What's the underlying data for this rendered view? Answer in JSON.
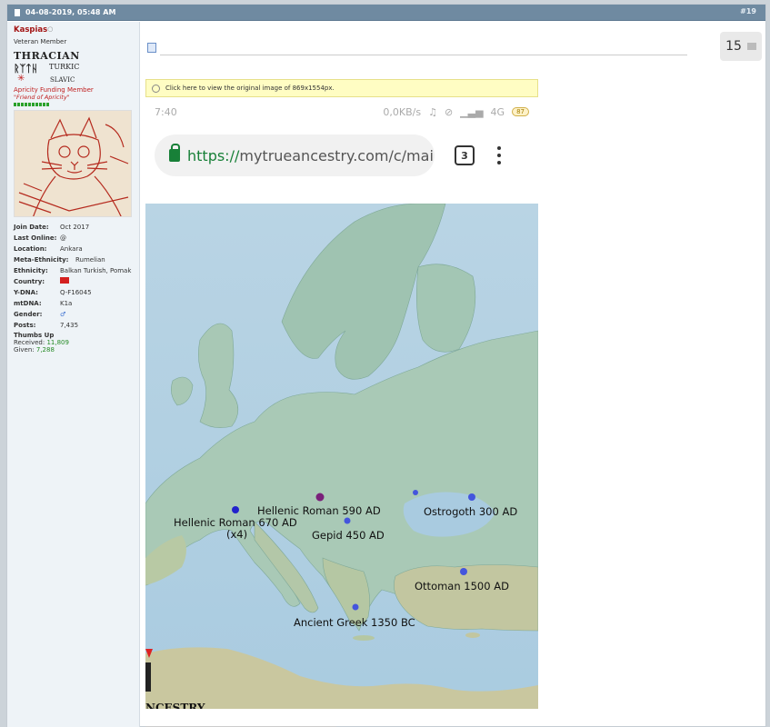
{
  "post": {
    "date": "04-08-2019, 05:48 AM",
    "number": "#19"
  },
  "user": {
    "name": "Kaspias",
    "status_icon": "offline-dot",
    "title": "Veteran Member",
    "banner_line1": "THRACIAN",
    "banner_line2": "TURKIC",
    "banner_line3": "SLAVIC",
    "funding": "Apricity Funding Member",
    "friend": "\"Friend of Apricity\"",
    "stats": [
      {
        "k": "Join Date:",
        "v": "Oct 2017"
      },
      {
        "k": "Last Online:",
        "v": "@"
      },
      {
        "k": "Location:",
        "v": "Ankara"
      },
      {
        "k": "Meta-Ethnicity:",
        "v": "Rumelian"
      },
      {
        "k": "Ethnicity:",
        "v": "Balkan Turkish, Pomak"
      },
      {
        "k": "Country:",
        "v": ""
      },
      {
        "k": "Y-DNA:",
        "v": "Q-F16045"
      },
      {
        "k": "mtDNA:",
        "v": "K1a"
      },
      {
        "k": "Gender:",
        "v": "♂"
      },
      {
        "k": "Posts:",
        "v": "7,435"
      }
    ],
    "thumbs_title": "Thumbs Up",
    "received_label": "Received:",
    "received": "11,809",
    "given_label": "Given:",
    "given": "7,288"
  },
  "counter": {
    "value": "15"
  },
  "image_notice": "Click here to view the original image of 869x1554px.",
  "phone": {
    "time": "7:40",
    "speed": "0,0KB/s",
    "network": "4G",
    "battery": "87",
    "url_scheme": "https://",
    "url_rest": "mytrueancestry.com/c/mai",
    "tab_count": "3",
    "brand_fragment": "NCESTRY"
  },
  "map_labels": [
    "Hellenic Roman 590 AD",
    "Hellenic Roman 670 AD",
    "(x4)",
    "Gepid 450 AD",
    "Ostrogoth 300 AD",
    "Ottoman 1500 AD",
    "Ancient Greek 1350 BC"
  ],
  "colors": {
    "header": "#6f8aa1",
    "username": "#a31414",
    "sea": "#b7d5e6",
    "land": "#a9c9b6"
  }
}
